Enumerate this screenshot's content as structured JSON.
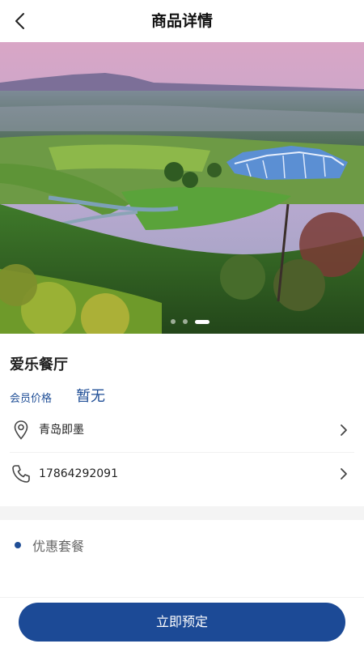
{
  "header": {
    "title": "商品详情"
  },
  "carousel": {
    "slide_count": 3,
    "active_index": 2
  },
  "shop": {
    "name": "爱乐餐厅",
    "member_price_label": "会员价格",
    "member_price_value": "暂无",
    "address": "青岛即墨",
    "phone": "17864292091"
  },
  "package": {
    "label": "优惠套餐"
  },
  "footer": {
    "book_label": "立即预定"
  },
  "colors": {
    "accent": "#1c4a96",
    "label_blue": "#1f4e96"
  },
  "icons": [
    "back-arrow-icon",
    "location-pin-icon",
    "phone-icon",
    "chevron-right-icon"
  ]
}
